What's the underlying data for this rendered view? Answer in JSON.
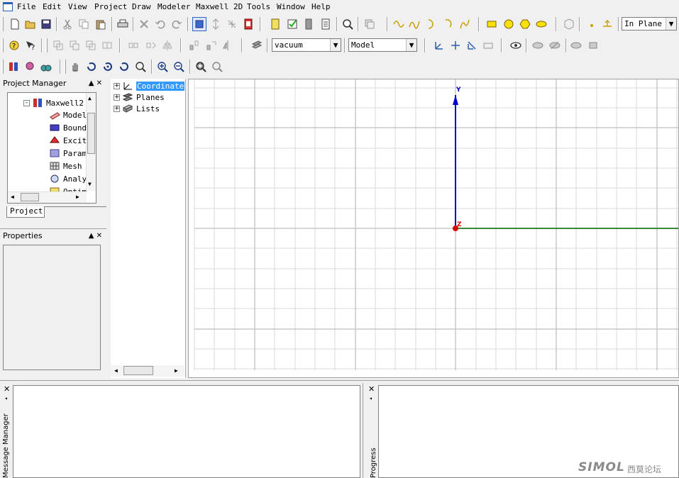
{
  "menu": [
    "File",
    "Edit",
    "View",
    "Project",
    "Draw",
    "Modeler",
    "Maxwell 2D",
    "Tools",
    "Window",
    "Help"
  ],
  "toolbar": {
    "plane_select": "In Plane",
    "material_select": "vacuum",
    "model_select": "Model"
  },
  "project_manager": {
    "title": "Project Manager",
    "pane_buttons": "▲ ✕",
    "tab": "Project",
    "items": [
      {
        "label": "Maxwell2",
        "icon": "maxwell-design-icon"
      },
      {
        "label": "Model",
        "icon": "model-icon"
      },
      {
        "label": "Bound",
        "icon": "boundaries-icon"
      },
      {
        "label": "Excit",
        "icon": "excitations-icon"
      },
      {
        "label": "Param",
        "icon": "parameters-icon"
      },
      {
        "label": "Mesh",
        "icon": "mesh-icon"
      },
      {
        "label": "Analy",
        "icon": "analysis-icon"
      },
      {
        "label": "Optim",
        "icon": "optimetrics-icon"
      }
    ]
  },
  "properties": {
    "title": "Properties",
    "pane_buttons": "▲ ✕"
  },
  "model_tree": {
    "items": [
      {
        "label": "Coordinate",
        "icon": "coordinate-system-icon",
        "selected": true
      },
      {
        "label": "Planes",
        "icon": "planes-icon",
        "selected": false
      },
      {
        "label": "Lists",
        "icon": "lists-icon",
        "selected": false
      }
    ]
  },
  "viewport": {
    "axis_y_label": "Y",
    "axis_z_label": "Z",
    "grid_color": "#d8d8d8",
    "y_axis_color": "#0000c8",
    "x_axis_color": "#007000",
    "origin_color": "#e00000"
  },
  "message_manager": {
    "title": "Message Manager"
  },
  "progress": {
    "title": "Progress"
  },
  "watermark": {
    "text": "SIMOL",
    "subtext": "西莫论坛"
  },
  "colors": {
    "selection": "#3399ff",
    "background": "#f0f0f0"
  }
}
